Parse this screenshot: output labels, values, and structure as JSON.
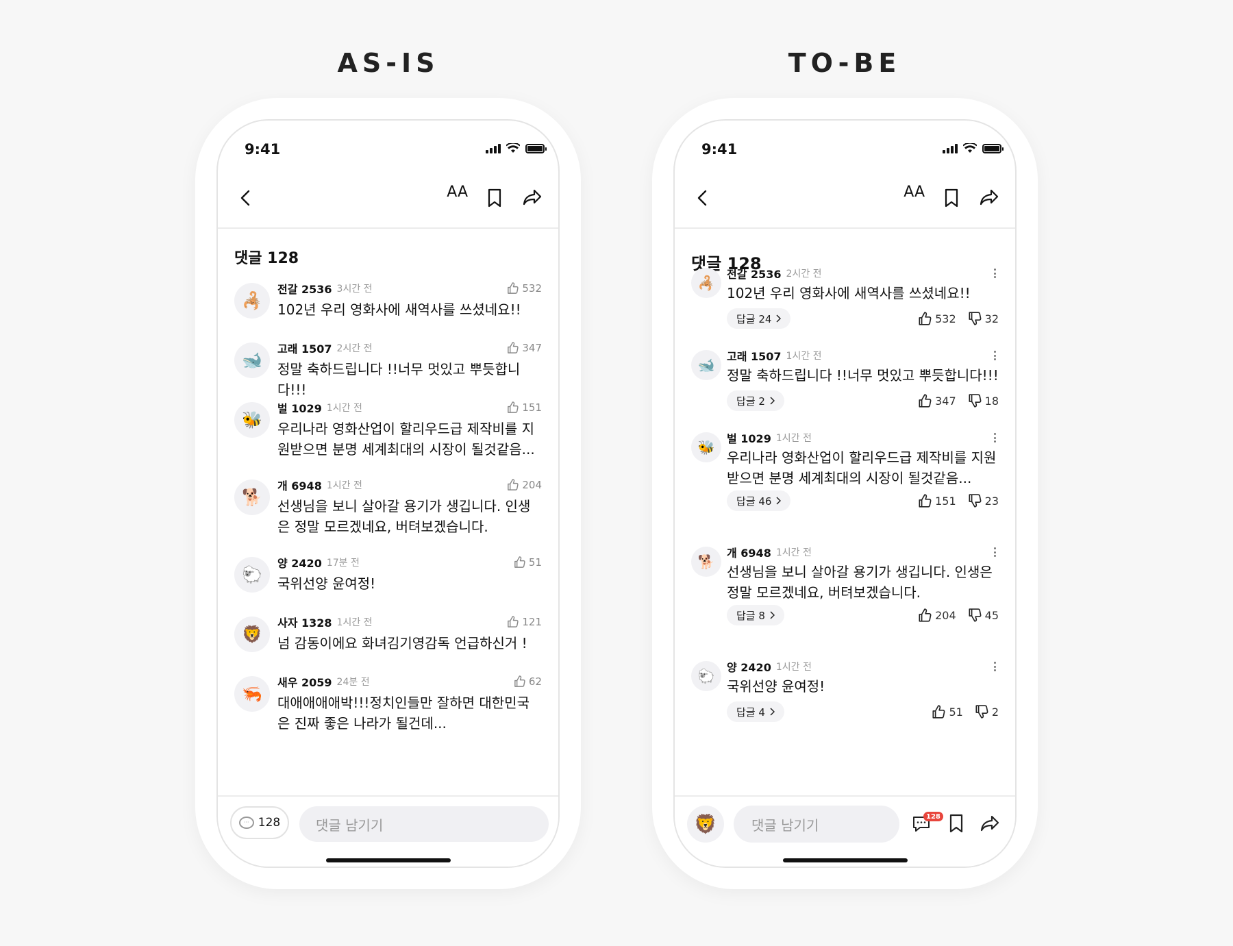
{
  "labels": {
    "asis": "AS-IS",
    "tobe": "TO-BE"
  },
  "status": {
    "time": "9:41"
  },
  "nav": {
    "font_size_label": "AA"
  },
  "asis": {
    "heading": "댓글 128",
    "comments": [
      {
        "avatar": "🦂",
        "name": "전갈 2536",
        "time": "3시간 전",
        "likes": "532",
        "text": "102년 우리 영화사에 새역사를 쓰셨네요!!"
      },
      {
        "avatar": "🐋",
        "name": "고래 1507",
        "time": "2시간 전",
        "likes": "347",
        "text": "정말 축하드립니다 !!너무 멋있고 뿌듯합니다!!!"
      },
      {
        "avatar": "🐝",
        "name": "벌 1029",
        "time": "1시간 전",
        "likes": "151",
        "text": "우리나라 영화산업이 할리우드급 제작비를 지원받으면 분명 세계최대의 시장이 될것같음..."
      },
      {
        "avatar": "🐕",
        "name": "개 6948",
        "time": "1시간 전",
        "likes": "204",
        "text": "선생님을 보니 살아갈 용기가 생깁니다. 인생은 정말 모르겠네요, 버텨보겠습니다."
      },
      {
        "avatar": "🐑",
        "name": "양 2420",
        "time": "17분 전",
        "likes": "51",
        "text": "국위선양 윤여정!"
      },
      {
        "avatar": "🦁",
        "name": "사자 1328",
        "time": "1시간 전",
        "likes": "121",
        "text": "넘 감동이에요 화녀김기영감독 언급하신거 !"
      },
      {
        "avatar": "🦐",
        "name": "새우 2059",
        "time": "24분 전",
        "likes": "62",
        "text": "대애애애애박!!!정치인들만 잘하면 대한민국은 진짜 좋은 나라가 될건데..."
      }
    ],
    "bottom": {
      "count": "128",
      "placeholder": "댓글 남기기"
    }
  },
  "tobe": {
    "heading": "댓글 128",
    "comments": [
      {
        "avatar": "🦂",
        "name": "전갈 2536",
        "time": "2시간 전",
        "text": "102년 우리 영화사에 새역사를 쓰셨네요!!",
        "reply": "답글 24",
        "likes": "532",
        "dislikes": "32"
      },
      {
        "avatar": "🐋",
        "name": "고래 1507",
        "time": "1시간 전",
        "text": "정말 축하드립니다 !!너무 멋있고 뿌듯합니다!!!",
        "reply": "답글 2",
        "likes": "347",
        "dislikes": "18"
      },
      {
        "avatar": "🐝",
        "name": "벌 1029",
        "time": "1시간 전",
        "text": "우리나라 영화산업이 할리우드급 제작비를 지원받으면 분명 세계최대의 시장이 될것같음...",
        "reply": "답글 46",
        "likes": "151",
        "dislikes": "23"
      },
      {
        "avatar": "🐕",
        "name": "개 6948",
        "time": "1시간 전",
        "text": "선생님을 보니 살아갈 용기가 생깁니다. 인생은 정말 모르겠네요, 버텨보겠습니다.",
        "reply": "답글 8",
        "likes": "204",
        "dislikes": "45"
      },
      {
        "avatar": "🐑",
        "name": "양 2420",
        "time": "1시간 전",
        "text": "국위선양 윤여정!",
        "reply": "답글 4",
        "likes": "51",
        "dislikes": "2"
      }
    ],
    "bottom": {
      "placeholder": "댓글 남기기",
      "badge": "128",
      "my_avatar": "🦁"
    }
  }
}
